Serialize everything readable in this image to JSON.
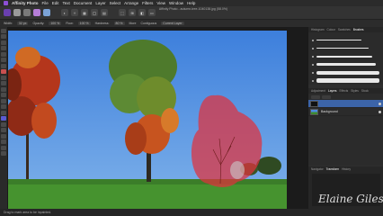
{
  "menubar": {
    "app_name": "Affinity Photo",
    "items": [
      "File",
      "Edit",
      "Text",
      "Document",
      "Layer",
      "Select",
      "Arrange",
      "Filters",
      "View",
      "Window",
      "Help"
    ]
  },
  "document": {
    "title": "Affinity Photo - autumn-tree-1040138.jpg (58.0%)"
  },
  "context_toolbar": {
    "width_label": "Width:",
    "width_value": "32 px",
    "opacity_label": "Opacity:",
    "opacity_value": "100 %",
    "flow_label": "Flow:",
    "flow_value": "100 %",
    "hardness_label": "Hardness:",
    "hardness_value": "80 %",
    "more_label": "More",
    "contiguous_label": "Contiguous",
    "current_layer_label": "Current Layer"
  },
  "panels": {
    "top_tabs": [
      "Histogram",
      "Colour",
      "Swatches",
      "Brushes"
    ],
    "active_top_tab": "Brushes",
    "layer_tabs": [
      "Adjustment",
      "Layers",
      "Effects",
      "Styles",
      "Stock"
    ],
    "active_layer_tab": "Layers",
    "layers": [
      {
        "name": "",
        "selected": true
      },
      {
        "name": "Background",
        "selected": false
      }
    ],
    "nav_tabs": [
      "Navigator",
      "Transform",
      "History"
    ],
    "active_nav_tab": "Transform"
  },
  "status": {
    "hint": "Drag to mark area to be inpainted."
  },
  "watermark": "Elaine Giles",
  "colors": {
    "accent": "#8d4fd6",
    "sky": "#4d8ae0",
    "grass": "#3f8a2e",
    "inpaint_mask": "#e0303c",
    "selected_layer": "#3c64a8"
  }
}
